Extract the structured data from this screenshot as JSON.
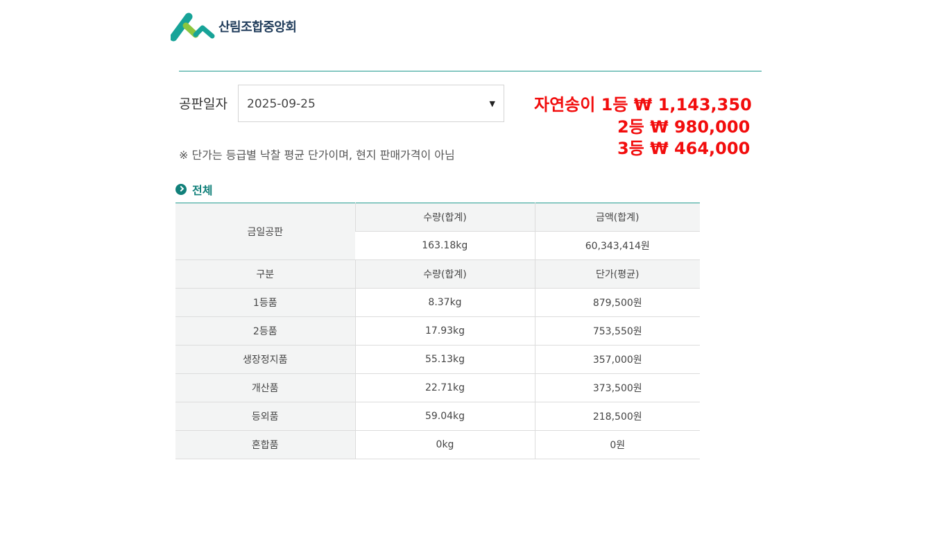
{
  "brand": {
    "name": "산림조합중앙회",
    "colors": {
      "teal": "#17a398",
      "green": "#8cc63f",
      "navy": "#1f3b5a"
    }
  },
  "filter": {
    "date_label": "공판일자",
    "date_value": "2025-09-25"
  },
  "prices": {
    "line1": "자연송이 1등 ₩ 1,143,350",
    "line2": "2등 ₩ 980,000",
    "line3": "3등 ₩ 464,000",
    "color": "#f20d0d"
  },
  "notice": "※ 단가는 등급별 낙찰 평균 단가이며, 현지 판매가격이 아님",
  "section": {
    "title": "전체"
  },
  "summary": {
    "label": "금일공판",
    "qty_header": "수량(합계)",
    "amount_header": "금액(합계)",
    "qty_value": "163.18kg",
    "amount_value": "60,343,414원"
  },
  "grades": {
    "headers": [
      "구분",
      "수량(합계)",
      "단가(평균)"
    ],
    "rows": [
      [
        "1등품",
        "8.37kg",
        "879,500원"
      ],
      [
        "2등품",
        "17.93kg",
        "753,550원"
      ],
      [
        "생장정지품",
        "55.13kg",
        "357,000원"
      ],
      [
        "개산품",
        "22.71kg",
        "373,500원"
      ],
      [
        "등외품",
        "59.04kg",
        "218,500원"
      ],
      [
        "혼합품",
        "0kg",
        "0원"
      ]
    ]
  }
}
